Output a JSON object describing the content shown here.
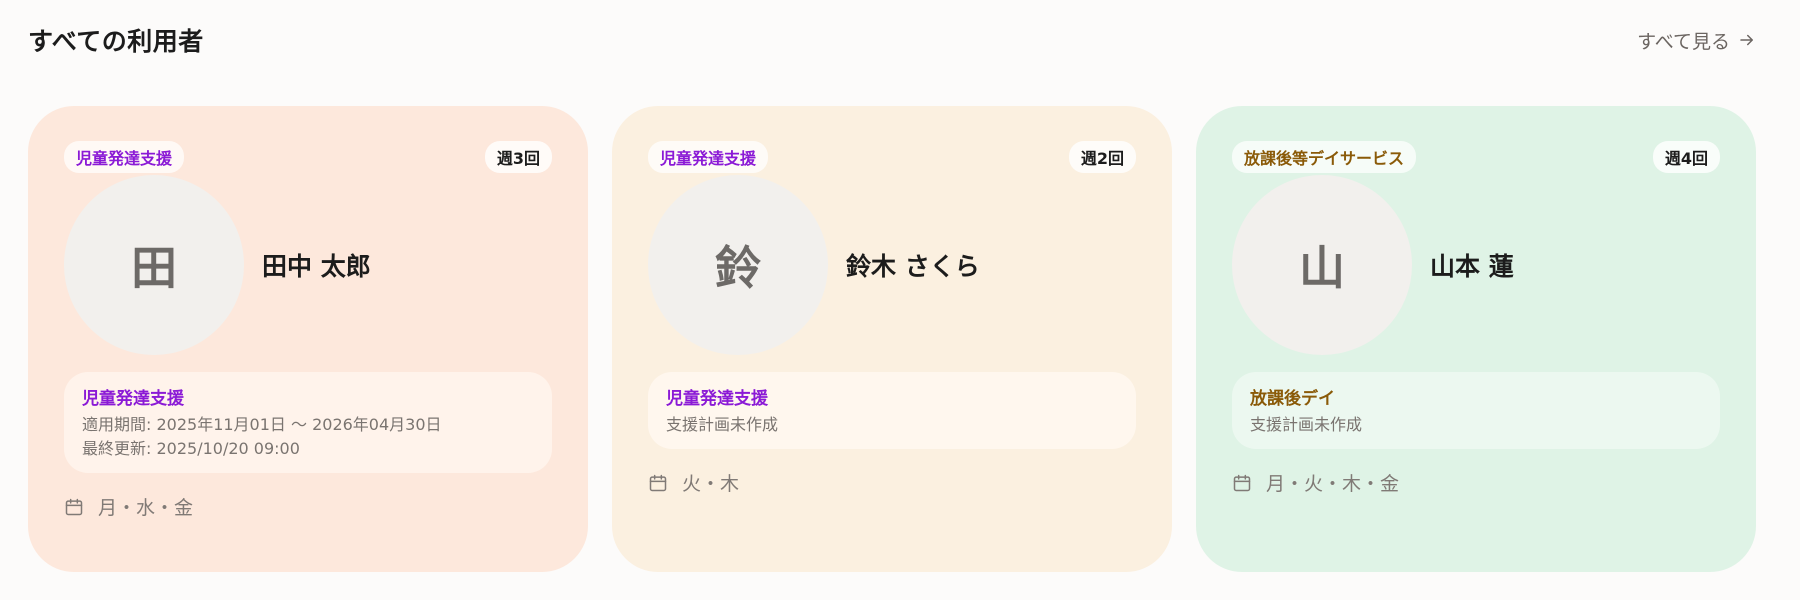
{
  "header": {
    "title": "すべての利用者",
    "see_all": "すべて見る"
  },
  "cards": [
    {
      "service": "児童発達支援",
      "frequency": "週3回",
      "avatar_char": "田",
      "name": "田中 太郎",
      "plan_title": "児童発達支援",
      "plan_period": "適用期間: 2025年11月01日 〜 2026年04月30日",
      "plan_updated": "最終更新: 2025/10/20 09:00",
      "days": "月・水・金"
    },
    {
      "service": "児童発達支援",
      "frequency": "週2回",
      "avatar_char": "鈴",
      "name": "鈴木 さくら",
      "plan_title": "児童発達支援",
      "plan_status": "支援計画未作成",
      "days": "火・木"
    },
    {
      "service": "放課後等デイサービス",
      "frequency": "週4回",
      "avatar_char": "山",
      "name": "山本 蓮",
      "plan_title": "放課後デイ",
      "plan_status": "支援計画未作成",
      "days": "月・火・木・金"
    }
  ],
  "colors": {
    "card_1_bg": "#fde8dc",
    "card_2_bg": "#fbf0e0",
    "card_3_bg": "#dff3e6",
    "service_purple": "#8b1ad6",
    "service_brown": "#8a5a08"
  },
  "icons": {
    "see_all": "arrow-right-icon",
    "days": "calendar-icon"
  }
}
